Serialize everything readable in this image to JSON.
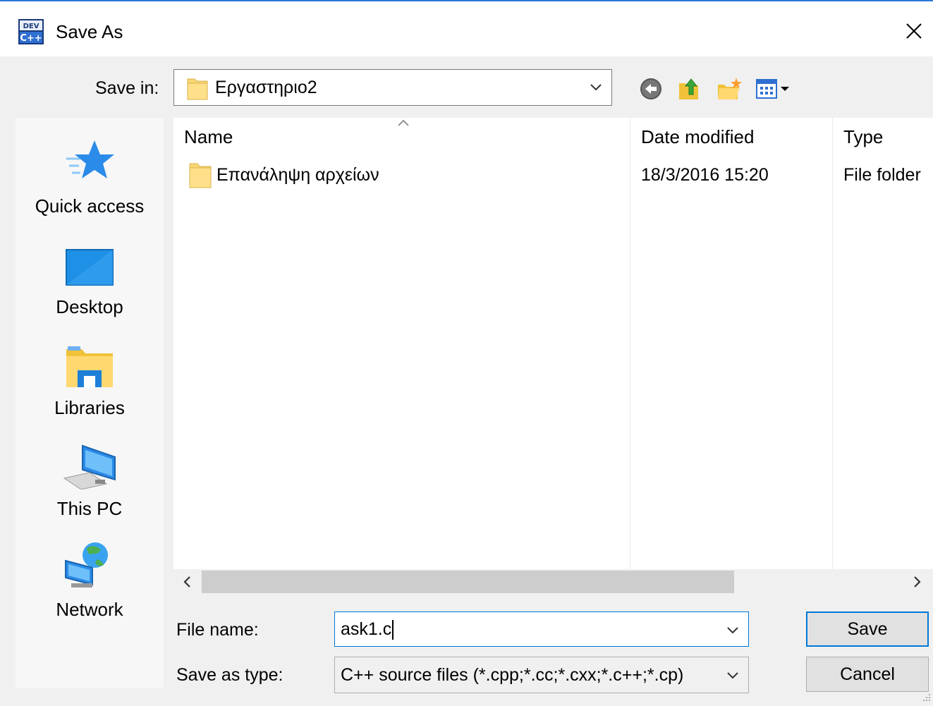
{
  "window": {
    "title": "Save As",
    "close_icon": "close-icon",
    "app_icon": "devcpp-app-icon"
  },
  "toolbar": {
    "save_in_label": "Save in:",
    "save_in_value": "Εργαστηριο2",
    "icons": [
      "back-icon",
      "up-folder-icon",
      "new-folder-icon",
      "view-menu-icon"
    ]
  },
  "places": [
    {
      "label": "Quick access",
      "icon": "quick-access-star-icon"
    },
    {
      "label": "Desktop",
      "icon": "desktop-icon"
    },
    {
      "label": "Libraries",
      "icon": "libraries-icon"
    },
    {
      "label": "This PC",
      "icon": "this-pc-icon"
    },
    {
      "label": "Network",
      "icon": "network-icon"
    }
  ],
  "file_list": {
    "columns": [
      "Name",
      "Date modified",
      "Type"
    ],
    "sorted_by": "Name",
    "rows": [
      {
        "name": "Επανάληψη αρχείων",
        "date": "18/3/2016 15:20",
        "type": "File folder",
        "icon": "folder-icon"
      }
    ]
  },
  "form": {
    "file_name_label": "File name:",
    "file_name_value": "ask1.c",
    "save_type_label": "Save as type:",
    "save_type_value": "C++ source files (*.cpp;*.cc;*.cxx;*.c++;*.cp)"
  },
  "buttons": {
    "save": "Save",
    "cancel": "Cancel"
  },
  "colors": {
    "accent": "#0078d7",
    "title_line": "#2b79d6",
    "folder": "#f8d775"
  }
}
